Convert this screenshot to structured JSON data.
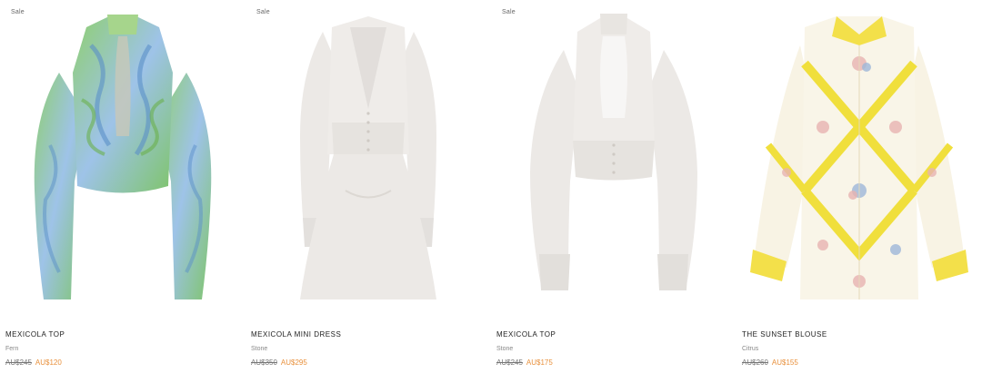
{
  "products": [
    {
      "badge": "Sale",
      "name": "MEXICOLA TOP",
      "color": "Fern",
      "price_old": "AU$245",
      "price_new": "AU$120",
      "image": "green-blue-swirl-print-blouse"
    },
    {
      "badge": "Sale",
      "name": "MEXICOLA MINI DRESS",
      "color": "Stone",
      "price_old": "AU$350",
      "price_new": "AU$295",
      "image": "stone-mini-dress"
    },
    {
      "badge": "Sale",
      "name": "MEXICOLA TOP",
      "color": "Stone",
      "price_old": "AU$245",
      "price_new": "AU$175",
      "image": "stone-cropped-blouse"
    },
    {
      "badge": "",
      "name": "THE SUNSET BLOUSE",
      "color": "Citrus",
      "price_old": "AU$260",
      "price_new": "AU$155",
      "image": "yellow-floral-shirt"
    }
  ],
  "colors": {
    "sale_price": "#e88f3a",
    "old_price": "#777777"
  }
}
